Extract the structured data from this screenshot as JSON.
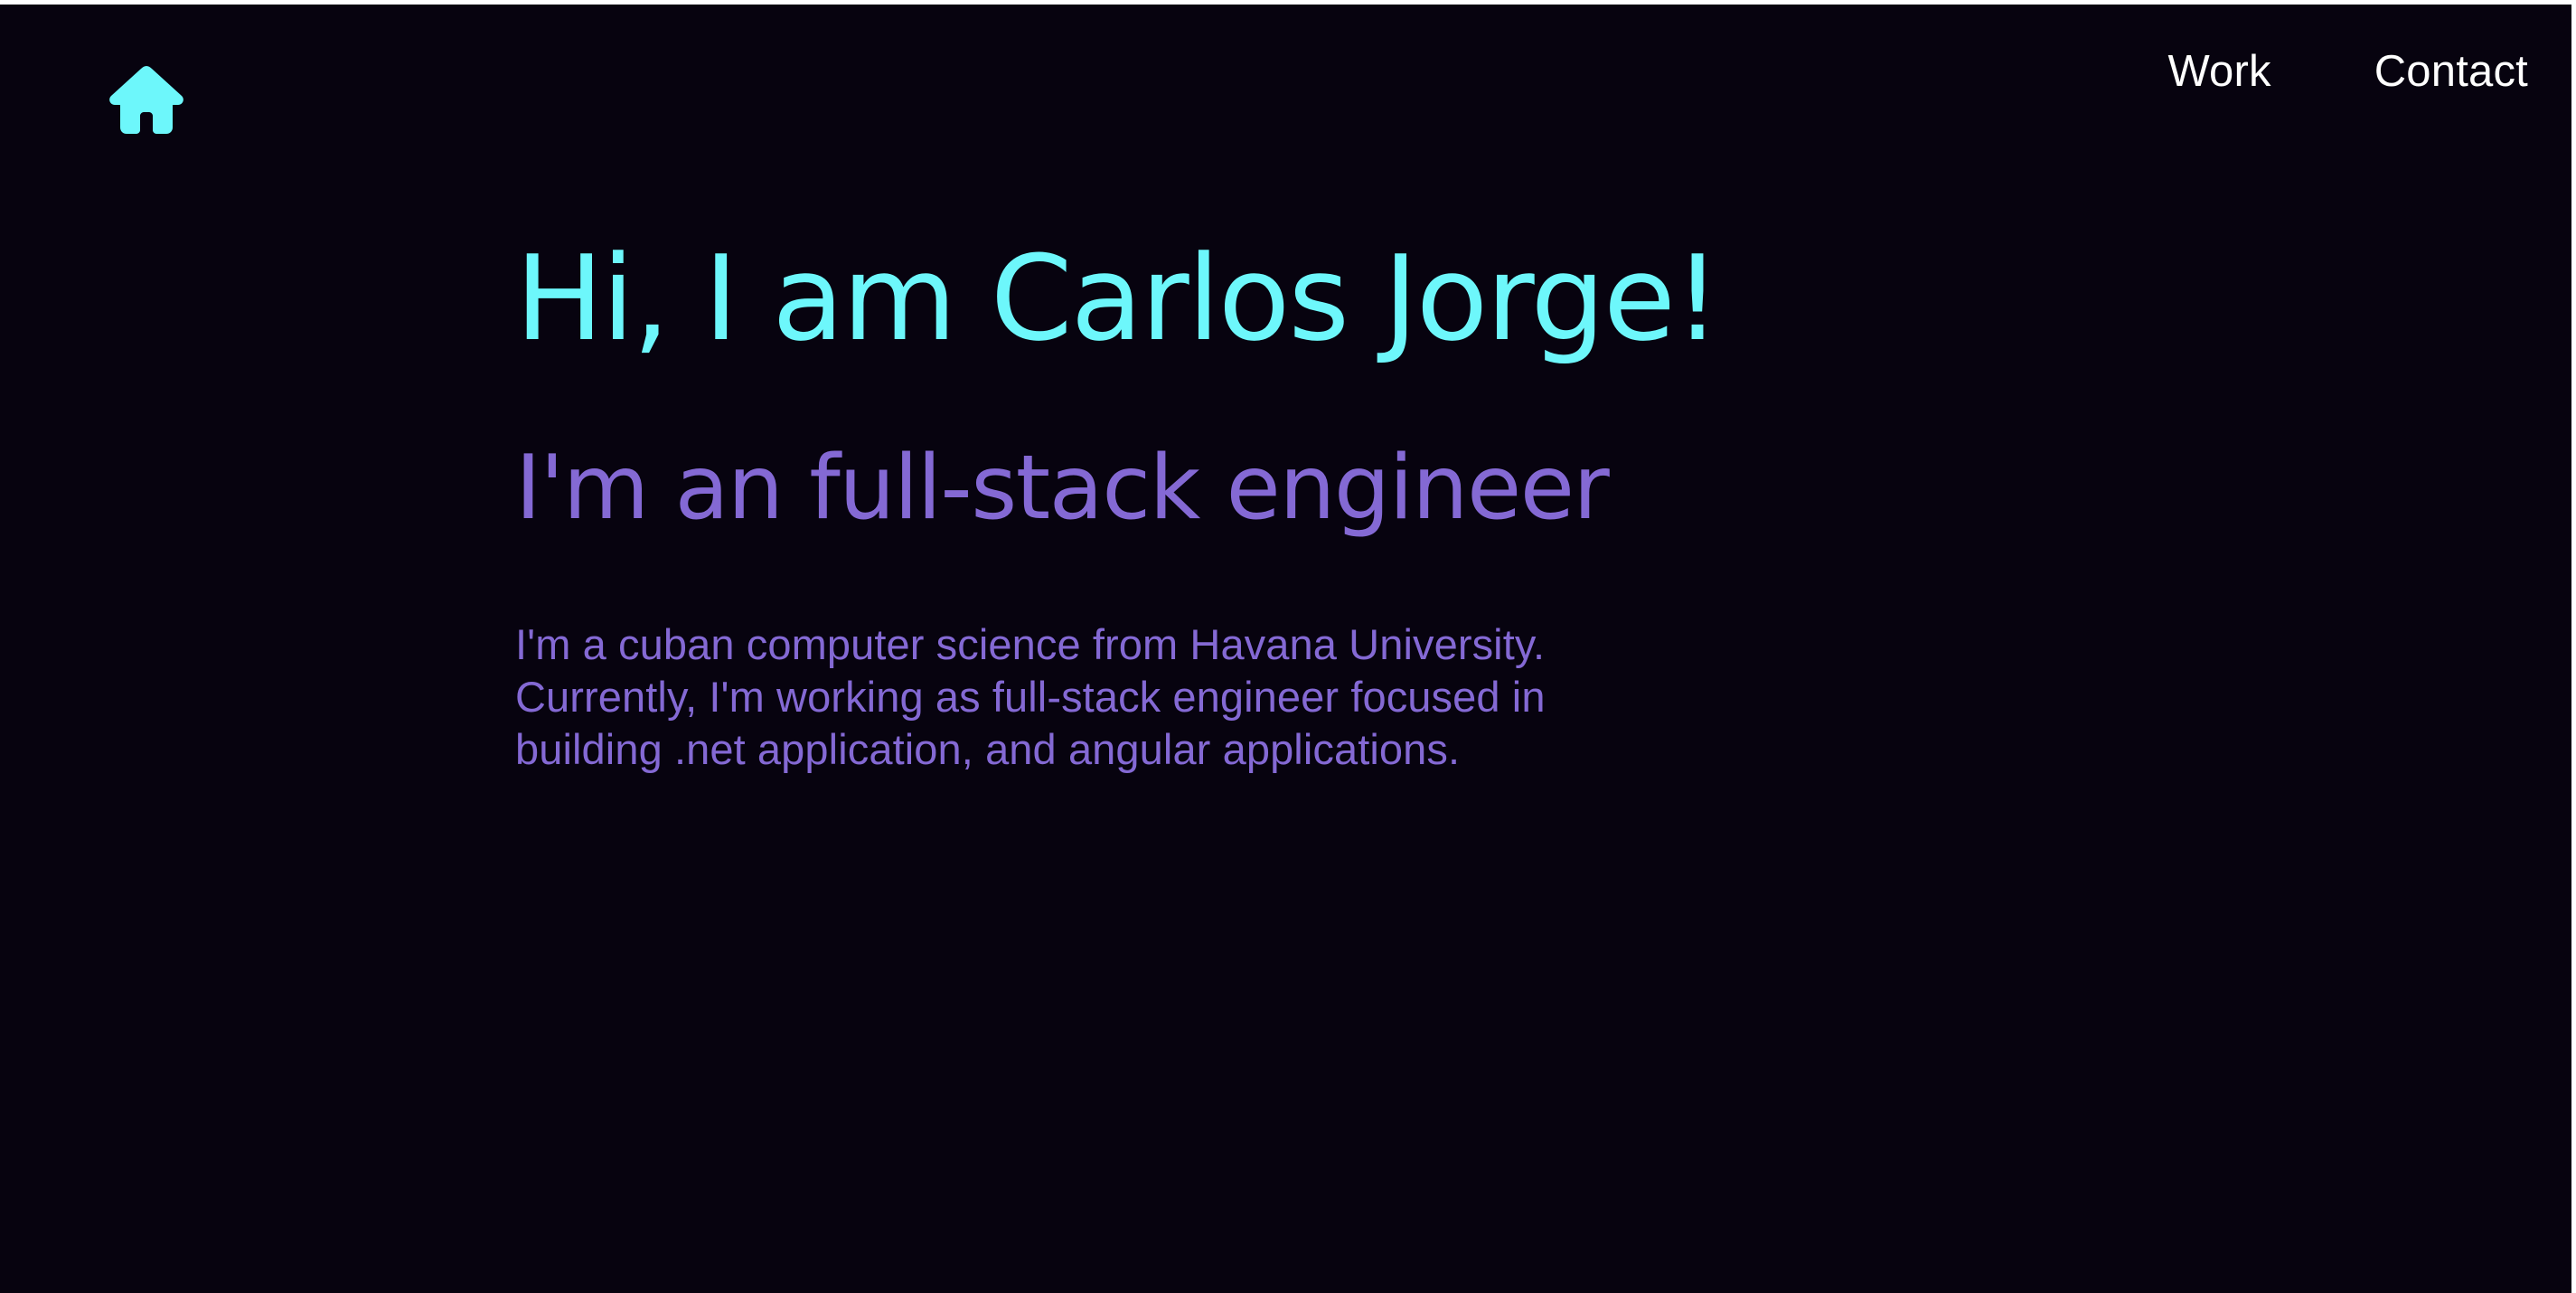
{
  "header": {
    "home_icon": "home-icon",
    "nav": [
      {
        "label": "Work"
      },
      {
        "label": "Contact"
      }
    ]
  },
  "hero": {
    "title": "Hi, I am Carlos Jorge!",
    "subtitle": "I'm an full-stack engineer",
    "bio": "I'm a cuban computer science from Havana University. Currently, I'm working as full-stack engineer focused in building .net application, and angular applications."
  },
  "colors": {
    "background": "#07030f",
    "accent_cyan": "#6df7fb",
    "accent_purple": "#8469d4",
    "nav_text": "#ffffff"
  }
}
